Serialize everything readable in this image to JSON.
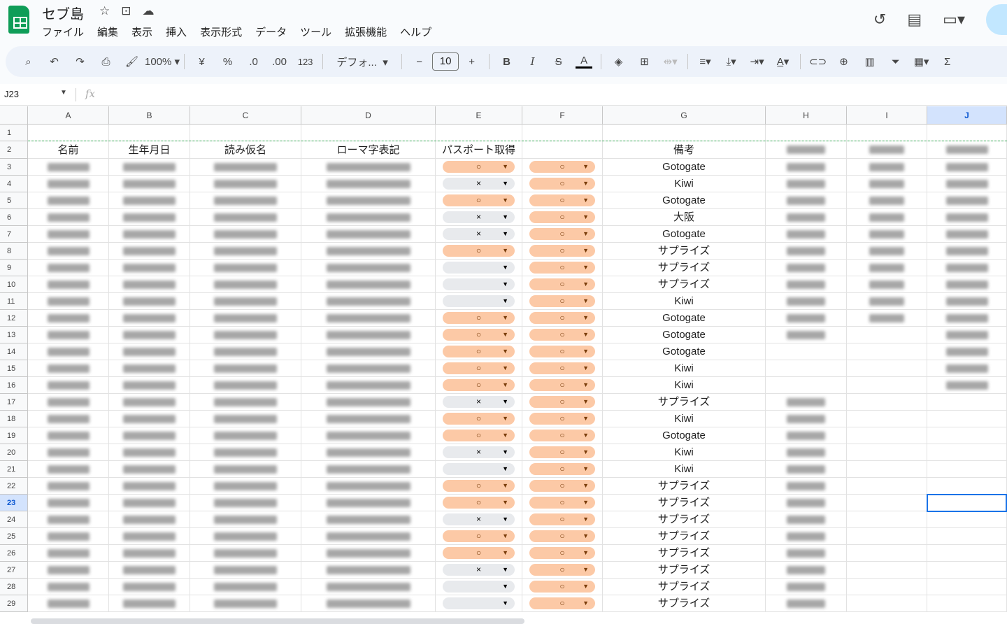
{
  "app": {
    "title": "セブ島",
    "name_box": "J23",
    "fx": "fx"
  },
  "menu": [
    "ファイル",
    "編集",
    "表示",
    "挿入",
    "表示形式",
    "データ",
    "ツール",
    "拡張機能",
    "ヘルプ"
  ],
  "toolbar": {
    "zoom": "100%",
    "currency": "¥",
    "percent": "%",
    "dec_less": ".0",
    "dec_more": ".00",
    "number_format": "123",
    "font": "デフォ...",
    "font_size": "10",
    "bold": "B",
    "italic": "I",
    "text_color": "A"
  },
  "columns": [
    "A",
    "B",
    "C",
    "D",
    "E",
    "F",
    "G",
    "H",
    "I",
    "J"
  ],
  "selected_cell": {
    "col": "J",
    "row": 23
  },
  "header_row": [
    "名前",
    "生年月日",
    "読み仮名",
    "ローマ字表記",
    "パスポート取得",
    "",
    "備考",
    "",
    "",
    ""
  ],
  "rows": [
    {
      "n": 3,
      "e": "○",
      "f": "○",
      "g": "Gotogate",
      "blur": "ABCDHIJ"
    },
    {
      "n": 4,
      "e": "×",
      "f": "○",
      "g": "Kiwi",
      "blur": "ABCDHIJ"
    },
    {
      "n": 5,
      "e": "○",
      "f": "○",
      "g": "Gotogate",
      "blur": "ABCDHIJ"
    },
    {
      "n": 6,
      "e": "×",
      "f": "○",
      "g": "大阪",
      "blur": "ABCDHIJ"
    },
    {
      "n": 7,
      "e": "×",
      "f": "○",
      "g": "Gotogate",
      "blur": "ABCDHIJ"
    },
    {
      "n": 8,
      "e": "○",
      "f": "○",
      "g": "サプライズ",
      "blur": "ABCDHIJ"
    },
    {
      "n": 9,
      "e": "",
      "f": "○",
      "g": "サプライズ",
      "blur": "ABCDHIJ"
    },
    {
      "n": 10,
      "e": "",
      "f": "○",
      "g": "サプライズ",
      "blur": "ABCDHIJ"
    },
    {
      "n": 11,
      "e": "",
      "f": "○",
      "g": "Kiwi",
      "blur": "ABCDHIJ"
    },
    {
      "n": 12,
      "e": "○",
      "f": "○",
      "g": "Gotogate",
      "blur": "ABCDHIJ"
    },
    {
      "n": 13,
      "e": "○",
      "f": "○",
      "g": "Gotogate",
      "blur": "ABCDHJ"
    },
    {
      "n": 14,
      "e": "○",
      "f": "○",
      "g": "Gotogate",
      "blur": "ABCDJ"
    },
    {
      "n": 15,
      "e": "○",
      "f": "○",
      "g": "Kiwi",
      "blur": "ABCDJ"
    },
    {
      "n": 16,
      "e": "○",
      "f": "○",
      "g": "Kiwi",
      "blur": "ABCDJ"
    },
    {
      "n": 17,
      "e": "×",
      "f": "○",
      "g": "サプライズ",
      "blur": "ABCDH"
    },
    {
      "n": 18,
      "e": "○",
      "f": "○",
      "g": "Kiwi",
      "blur": "ABCDH"
    },
    {
      "n": 19,
      "e": "○",
      "f": "○",
      "g": "Gotogate",
      "blur": "ABCDH"
    },
    {
      "n": 20,
      "e": "×",
      "f": "○",
      "g": "Kiwi",
      "blur": "ABCDH"
    },
    {
      "n": 21,
      "e": "",
      "f": "○",
      "g": "Kiwi",
      "blur": "ABCDH"
    },
    {
      "n": 22,
      "e": "○",
      "f": "○",
      "g": "サプライズ",
      "blur": "ABCDH"
    },
    {
      "n": 23,
      "e": "○",
      "f": "○",
      "g": "サプライズ",
      "blur": "ABCDH"
    },
    {
      "n": 24,
      "e": "×",
      "f": "○",
      "g": "サプライズ",
      "blur": "ABCDH"
    },
    {
      "n": 25,
      "e": "○",
      "f": "○",
      "g": "サプライズ",
      "blur": "ABCDH"
    },
    {
      "n": 26,
      "e": "○",
      "f": "○",
      "g": "サプライズ",
      "blur": "ABCDH"
    },
    {
      "n": 27,
      "e": "×",
      "f": "○",
      "g": "サプライズ",
      "blur": "ABCDH"
    },
    {
      "n": 28,
      "e": "",
      "f": "○",
      "g": "サプライズ",
      "blur": "ABCDH"
    },
    {
      "n": 29,
      "e": "",
      "f": "○",
      "g": "サプライズ",
      "blur": "ABCDH"
    }
  ],
  "colors": {
    "chip_yes": "#fcc9a6",
    "chip_no": "#e8eaed",
    "selection": "#1a73e8"
  }
}
